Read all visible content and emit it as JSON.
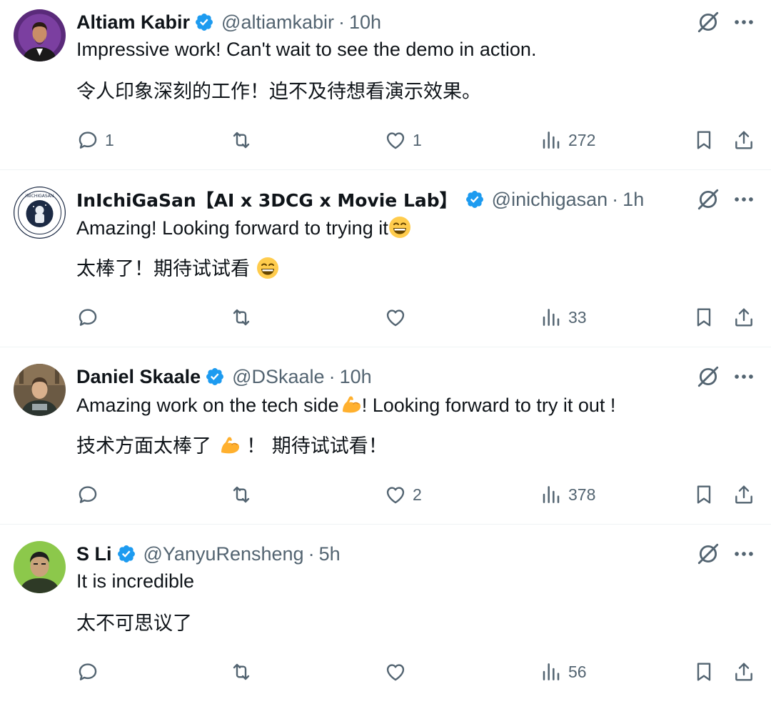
{
  "colors": {
    "text": "#0f1419",
    "secondary": "#536471",
    "verified": "#1d9bf0",
    "divider": "#eff3f4"
  },
  "icons": [
    "verified-badge-icon",
    "grok-icon",
    "more-icon",
    "reply-icon",
    "retweet-icon",
    "like-icon",
    "views-icon",
    "bookmark-icon",
    "share-icon",
    "grin-emoji",
    "flexed-biceps-emoji"
  ],
  "tweets": [
    {
      "name": "Altiam Kabir",
      "handle": "@altiamkabir",
      "sep": "·",
      "time": "10h",
      "line1": "Impressive work! Can't wait to see the demo in action.",
      "line2": "令人印象深刻的工作！迫不及待想看演示效果。",
      "replies": "1",
      "retweets": "",
      "likes": "1",
      "views": "272"
    },
    {
      "name": "InIchiGaSan【AI x 3DCG x Movie Lab】",
      "handle": "@inichigasan",
      "sep": "·",
      "time": "1h",
      "line1": "Amazing! Looking forward to trying it",
      "line2": "太棒了！期待试试看 ",
      "replies": "",
      "retweets": "",
      "likes": "",
      "views": "33",
      "avatar_text": "INICHIGASAN"
    },
    {
      "name": "Daniel Skaale",
      "handle": "@DSkaale",
      "sep": "·",
      "time": "10h",
      "line1a": "Amazing work on the tech side",
      "line1b": "! Looking forward to try it out !",
      "line2a": "技术方面太棒了 ",
      "line2b": " ！ 期待试试看！",
      "replies": "",
      "retweets": "",
      "likes": "2",
      "views": "378"
    },
    {
      "name": "S Li",
      "handle": "@YanyuRensheng",
      "sep": "·",
      "time": "5h",
      "line1": "It is incredible",
      "line2": "太不可思议了",
      "replies": "",
      "retweets": "",
      "likes": "",
      "views": "56"
    }
  ]
}
